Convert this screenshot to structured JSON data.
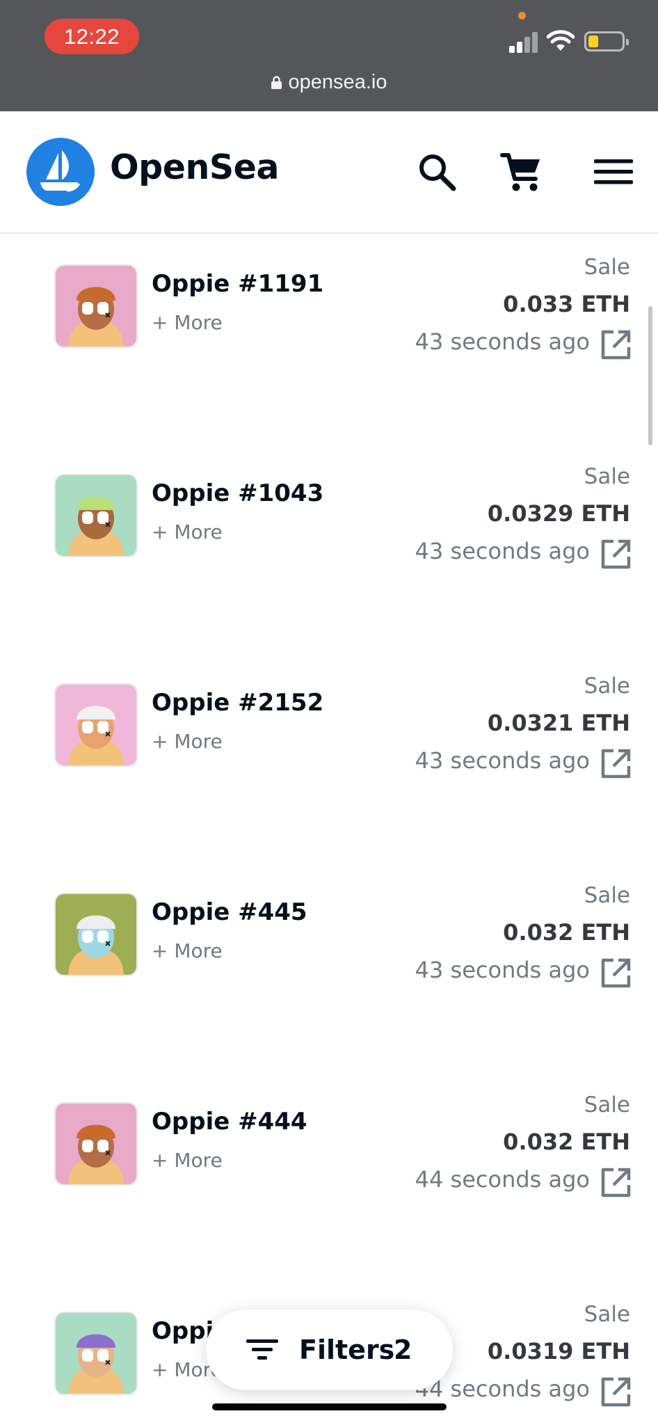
{
  "status_bar": {
    "time": "12:22",
    "url": "opensea.io",
    "icons": [
      "signal-icon",
      "wifi-icon",
      "battery-icon"
    ]
  },
  "header": {
    "brand": "OpenSea",
    "logo_color": "#2081e2",
    "icons": [
      "search-icon",
      "cart-icon",
      "menu-icon"
    ]
  },
  "activity": [
    {
      "name": "Oppie #1191",
      "more": "+ More",
      "event": "Sale",
      "price": "0.033 ETH",
      "time": "43 seconds ago",
      "bg": "#e9a9c9",
      "hat": "#c86a2c",
      "face": "#b56e43"
    },
    {
      "name": "Oppie #1043",
      "more": "+ More",
      "event": "Sale",
      "price": "0.0329 ETH",
      "time": "43 seconds ago",
      "bg": "#a9dcc2",
      "hat": "#b9e07a",
      "face": "#a8693d"
    },
    {
      "name": "Oppie #2152",
      "more": "+ More",
      "event": "Sale",
      "price": "0.0321 ETH",
      "time": "43 seconds ago",
      "bg": "#f0b7d8",
      "hat": "#f2f2f2",
      "face": "#e7a26f"
    },
    {
      "name": "Oppie #445",
      "more": "+ More",
      "event": "Sale",
      "price": "0.032 ETH",
      "time": "43 seconds ago",
      "bg": "#9eae55",
      "hat": "#eeeeee",
      "face": "#9ed8e8"
    },
    {
      "name": "Oppie #444",
      "more": "+ More",
      "event": "Sale",
      "price": "0.032 ETH",
      "time": "44 seconds ago",
      "bg": "#e9a9c9",
      "hat": "#c86a2c",
      "face": "#b56e43"
    },
    {
      "name": "Oppie",
      "more": "+ More",
      "event": "Sale",
      "price": "0.0319 ETH",
      "time": "44 seconds ago",
      "bg": "#a9dcc2",
      "hat": "#8b6fd0",
      "face": "#e7b48a"
    }
  ],
  "filters": {
    "label": "Filters",
    "count": "2"
  },
  "colors": {
    "text_primary": "#04111d",
    "text_secondary": "#707a83",
    "price": "#353840",
    "status_bar": "#555659",
    "time_pill": "#e6473d"
  }
}
